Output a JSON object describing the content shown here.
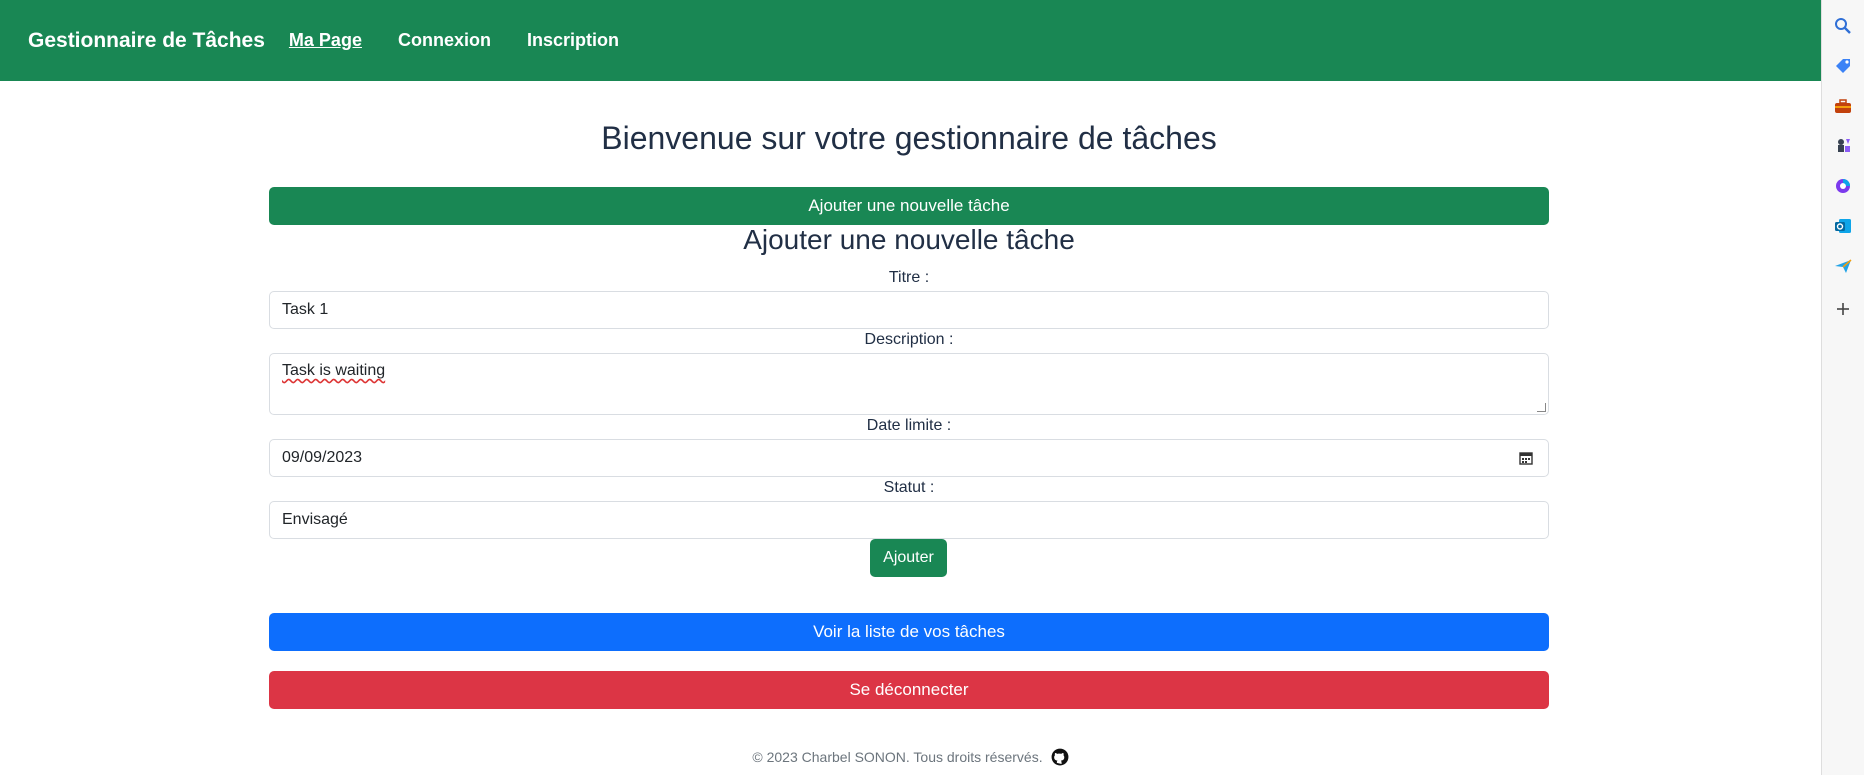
{
  "navbar": {
    "brand": "Gestionnaire de Tâches",
    "links": [
      "Ma Page",
      "Connexion",
      "Inscription"
    ]
  },
  "main": {
    "title": "Bienvenue sur votre gestionnaire de tâches",
    "add_new_button": "Ajouter une nouvelle tâche",
    "form": {
      "heading": "Ajouter une nouvelle tâche",
      "title_label": "Titre :",
      "title_value": "Task 1",
      "description_label": "Description :",
      "description_value": "Task is waiting",
      "deadline_label": "Date limite :",
      "deadline_value": "09/09/2023",
      "status_label": "Statut :",
      "status_value": "Envisagé",
      "submit_label": "Ajouter"
    },
    "list_button": "Voir la liste de vos tâches",
    "logout_button": "Se déconnecter"
  },
  "footer": {
    "text": "© 2023 Charbel SONON. Tous droits réservés."
  },
  "sidebar": {
    "icons": [
      "search-icon",
      "tag-icon",
      "toolbox-icon",
      "chess-icon",
      "office-icon",
      "outlook-icon",
      "send-icon",
      "plus-icon"
    ]
  },
  "colors": {
    "primary_green": "#198754",
    "blue": "#0d6efd",
    "red": "#dc3545"
  }
}
